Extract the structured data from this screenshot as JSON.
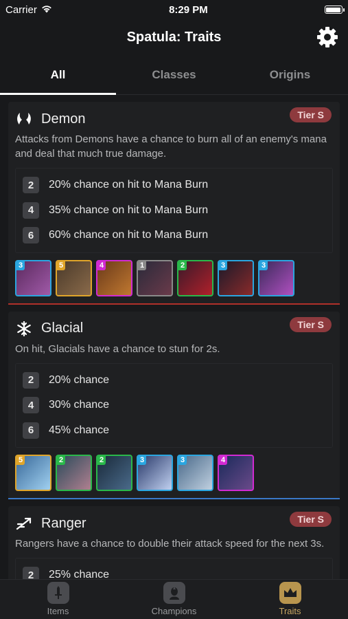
{
  "status": {
    "carrier": "Carrier",
    "time": "8:29 PM"
  },
  "nav": {
    "title": "Spatula: Traits"
  },
  "tabs": [
    {
      "label": "All",
      "active": true
    },
    {
      "label": "Classes",
      "active": false
    },
    {
      "label": "Origins",
      "active": false
    }
  ],
  "traits": [
    {
      "name": "Demon",
      "icon": "demon-horns-icon",
      "tier": "Tier S",
      "description": "Attacks from Demons have a chance to burn all of an enemy's mana and deal that much true damage.",
      "bonuses": [
        {
          "count": "2",
          "text": "20% chance on hit to Mana Burn"
        },
        {
          "count": "4",
          "text": "35% chance on hit to Mana Burn"
        },
        {
          "count": "6",
          "text": "60% chance on hit to Mana Burn"
        }
      ],
      "champions": [
        {
          "cost": "3",
          "color": "#2aa6e0",
          "art1": "#5b2a5e",
          "art2": "#a05aa8"
        },
        {
          "cost": "5",
          "color": "#e0a52a",
          "art1": "#4a3a2a",
          "art2": "#8a6a4a"
        },
        {
          "cost": "4",
          "color": "#d22ad2",
          "art1": "#6a3a1a",
          "art2": "#c07830"
        },
        {
          "cost": "1",
          "color": "#8a8a8a",
          "art1": "#2a2a3a",
          "art2": "#6a3a4a"
        },
        {
          "cost": "2",
          "color": "#2ab84a",
          "art1": "#3a1a2a",
          "art2": "#b0202a"
        },
        {
          "cost": "3",
          "color": "#2aa6e0",
          "art1": "#1a1a2a",
          "art2": "#8a2a2a"
        },
        {
          "cost": "3",
          "color": "#2aa6e0",
          "art1": "#3a2a5a",
          "art2": "#b050c0"
        }
      ],
      "divider_color": "#b0302a"
    },
    {
      "name": "Glacial",
      "icon": "snowflake-icon",
      "tier": "Tier S",
      "description": "On hit, Glacials have a chance to stun for 2s.",
      "bonuses": [
        {
          "count": "2",
          "text": "20% chance"
        },
        {
          "count": "4",
          "text": "30% chance"
        },
        {
          "count": "6",
          "text": "45% chance"
        }
      ],
      "champions": [
        {
          "cost": "5",
          "color": "#e0a52a",
          "art1": "#3a6a9a",
          "art2": "#a0d0f0"
        },
        {
          "cost": "2",
          "color": "#2ab84a",
          "art1": "#2a4a5a",
          "art2": "#b08090"
        },
        {
          "cost": "2",
          "color": "#2ab84a",
          "art1": "#1a2a3a",
          "art2": "#4a6a8a"
        },
        {
          "cost": "3",
          "color": "#2aa6e0",
          "art1": "#2a3a6a",
          "art2": "#c0d0f0"
        },
        {
          "cost": "3",
          "color": "#2aa6e0",
          "art1": "#4a6a8a",
          "art2": "#c0d0e0"
        },
        {
          "cost": "4",
          "color": "#d22ad2",
          "art1": "#1a2a5a",
          "art2": "#6a4a8a"
        }
      ],
      "divider_color": "#3a78c8"
    },
    {
      "name": "Ranger",
      "icon": "ranger-arrow-icon",
      "tier": "Tier S",
      "description": "Rangers have a chance to double their attack speed for the next 3s.",
      "bonuses": [
        {
          "count": "2",
          "text": "25% chance"
        }
      ],
      "champions": [],
      "divider_color": "#2a2b2e"
    }
  ],
  "bottom_tabs": [
    {
      "label": "Items",
      "icon": "sword-icon",
      "active": false
    },
    {
      "label": "Champions",
      "icon": "champion-icon",
      "active": false
    },
    {
      "label": "Traits",
      "icon": "crown-icon",
      "active": true
    }
  ]
}
